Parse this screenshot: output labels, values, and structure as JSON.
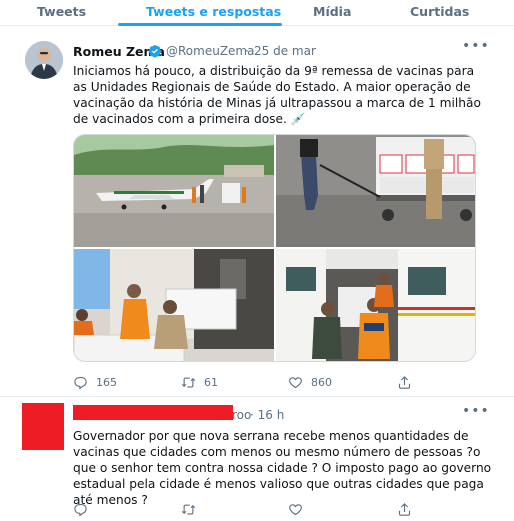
{
  "tabs": [
    {
      "label": "Tweets",
      "active": false
    },
    {
      "label": "Tweets e respostas",
      "active": true
    },
    {
      "label": "Mídia",
      "active": false
    },
    {
      "label": "Curtidas",
      "active": false
    }
  ],
  "tweet": {
    "author_name": "Romeu Zema",
    "handle": "@RomeuZema",
    "separator": "·",
    "date": "25 de mar",
    "more_icon": "more-horizontal-icon",
    "text": "Iniciamos há pouco, a distribuição da 9ª remessa de vacinas para as Unidades Regionais de Saúde do Estado. A maior operação de vacinação da história de Minas já ultrapassou a marca de 1 milhão de vacinados com a primeira dose.",
    "emoji": "💉",
    "media_photos": [
      "airplane-on-runway-photo",
      "vaccine-boxes-cart-photo",
      "vaccine-coolers-loading-photo",
      "aircraft-cargo-door-photo"
    ],
    "actions": {
      "reply_count": "165",
      "retweet_count": "61",
      "like_count": "860"
    }
  },
  "reply": {
    "handle_fragment": "roo",
    "separator": "·",
    "date": "16 h",
    "more_icon": "more-horizontal-icon",
    "text": "Governador por que nova serrana recebe menos quantidades de vacinas que cidades com menos ou mesmo número de pessoas ?o que o senhor tem contra nossa cidade ? O imposto pago ao governo estadual pela cidade é menos valioso que outras cidades que paga até menos ?",
    "actions": {
      "reply_count": "",
      "retweet_count": "",
      "like_count": ""
    }
  },
  "colors": {
    "accent": "#1da1f2",
    "muted": "#5b7083",
    "redaction": "#ee1c24",
    "verified": "#1da1f2"
  }
}
